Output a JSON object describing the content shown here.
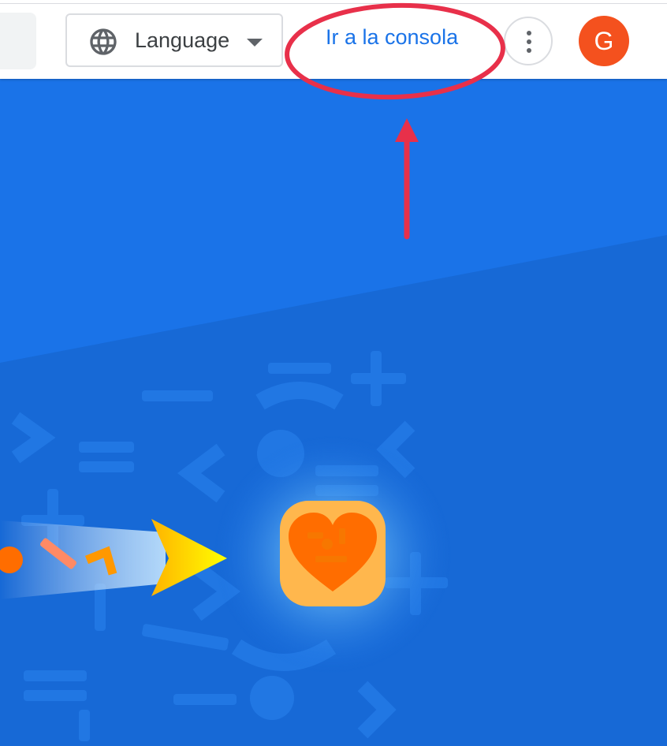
{
  "header": {
    "language_label": "Language",
    "console_link": "Ir a la consola",
    "avatar_initial": "G"
  },
  "icons": {
    "language": "globe-icon",
    "language_dropdown": "caret-down-icon",
    "more": "more-vert-icon"
  },
  "colors": {
    "link": "#1a73e8",
    "avatar": "#f4511e",
    "hero_background": "#1a73e8",
    "annotation": "#e8304a",
    "heart_tile": "#ffb74d",
    "heart": "#ff6d00",
    "arrow_gradient_end": "#ffd600"
  }
}
